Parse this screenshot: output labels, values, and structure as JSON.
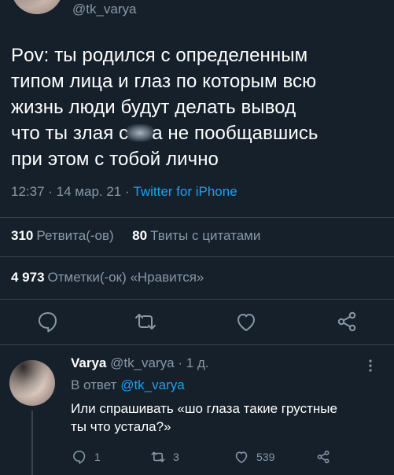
{
  "colors": {
    "background": "#15202b",
    "text_primary": "#ffffff",
    "text_secondary": "#8899a6",
    "link": "#1da1f2",
    "divider": "#38444d"
  },
  "main_tweet": {
    "handle": "@tk_varya",
    "text_lines": [
      "Pov: ты родился с определенным",
      "типом лица и глаз по которым всю",
      "жизнь люди будут делать вывод",
      "что ты злая с",
      "а не пообщавшись",
      "при этом с тобой лично"
    ],
    "time": "12:37",
    "date": "14 мар. 21",
    "source": "Twitter for iPhone",
    "retweets_count": "310",
    "retweets_label": "Ретвита(-ов)",
    "quotes_count": "80",
    "quotes_label": "Твиты с цитатами",
    "likes_count": "4 973",
    "likes_label": "Отметки(-ок) «Нравится»",
    "actions": [
      "reply-icon",
      "retweet-icon",
      "like-icon",
      "share-icon"
    ]
  },
  "reply": {
    "name": "Varya",
    "handle": "@tk_varya",
    "age": "1 д.",
    "reply_to_label": "В ответ",
    "reply_to_handle": "@tk_varya",
    "text_lines": [
      "Или спрашивать «шо глаза такие грустные",
      "ты что устала?»"
    ],
    "reply_count": "1",
    "retweet_count": "3",
    "like_count": "539"
  }
}
